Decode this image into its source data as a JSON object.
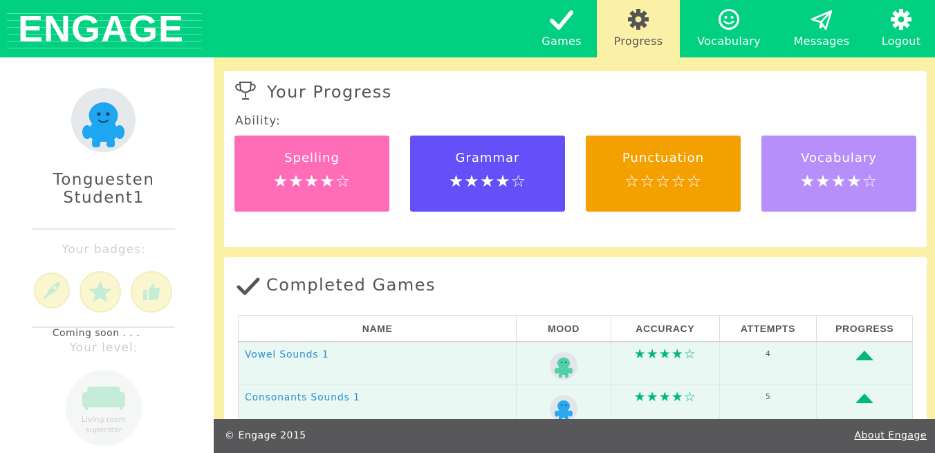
{
  "brand": {
    "logo_text": "ENGAGE"
  },
  "nav": {
    "games": {
      "label": "Games",
      "icon": "checkmark-icon"
    },
    "progress": {
      "label": "Progress",
      "icon": "gear-icon"
    },
    "vocabulary": {
      "label": "Vocabulary",
      "icon": "smiley-icon"
    },
    "messages": {
      "label": "Messages",
      "icon": "paper-plane-icon"
    },
    "logout": {
      "label": "Logout",
      "icon": "gear-icon"
    }
  },
  "sidebar": {
    "name_line1": "Tonguesten",
    "name_line2": "Student1",
    "badges_title": "Your badges:",
    "coming_soon": "Coming soon . . .",
    "level_title": "Your level:",
    "level_line1": "Living room",
    "level_line2": "superstar"
  },
  "progress": {
    "title": "Your Progress",
    "ability_label": "Ability:",
    "skills": [
      {
        "name": "Spelling",
        "stars": 4,
        "max": 5,
        "color": "#ff6cb8"
      },
      {
        "name": "Grammar",
        "stars": 4,
        "max": 5,
        "color": "#6450f9"
      },
      {
        "name": "Punctuation",
        "stars": 0,
        "max": 5,
        "color": "#f4a000"
      },
      {
        "name": "Vocabulary",
        "stars": 4,
        "max": 5,
        "color": "#b78ffa"
      }
    ]
  },
  "completed": {
    "title": "Completed Games",
    "columns": [
      "NAME",
      "MOOD",
      "ACCURACY",
      "ATTEMPTS",
      "PROGRESS"
    ],
    "rows": [
      {
        "name": "Vowel Sounds 1",
        "mood_color": "#50cfa8",
        "accuracy": 4,
        "accuracy_max": 5,
        "attempts": "4",
        "progress": "up"
      },
      {
        "name": "Consonants Sounds 1",
        "mood_color": "#2aa8f0",
        "accuracy": 4,
        "accuracy_max": 5,
        "attempts": "5",
        "progress": "up"
      }
    ]
  },
  "footer": {
    "copyright": "© Engage 2015",
    "about": "About Engage"
  },
  "colors": {
    "header": "#02d081",
    "accent": "#00b87a",
    "background": "#fbf1a6",
    "footer": "#58585a"
  }
}
